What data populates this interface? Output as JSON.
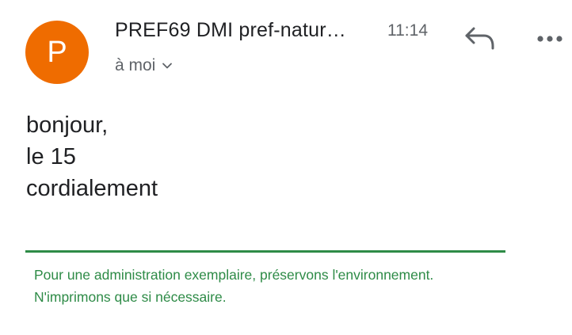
{
  "header": {
    "avatar_letter": "P",
    "avatar_color": "#ef6c00",
    "sender": "PREF69 DMI pref-natur…",
    "time": "11:14",
    "recipient": "à moi",
    "reply_icon": "reply-icon",
    "more_icon": "more-options-icon"
  },
  "body": {
    "lines": [
      "bonjour,",
      "le 15",
      "cordialement"
    ]
  },
  "signature": {
    "color": "#2e8b47",
    "lines": [
      "Pour une administration exemplaire, préservons l'environnement.",
      "N'imprimons que si nécessaire."
    ]
  }
}
